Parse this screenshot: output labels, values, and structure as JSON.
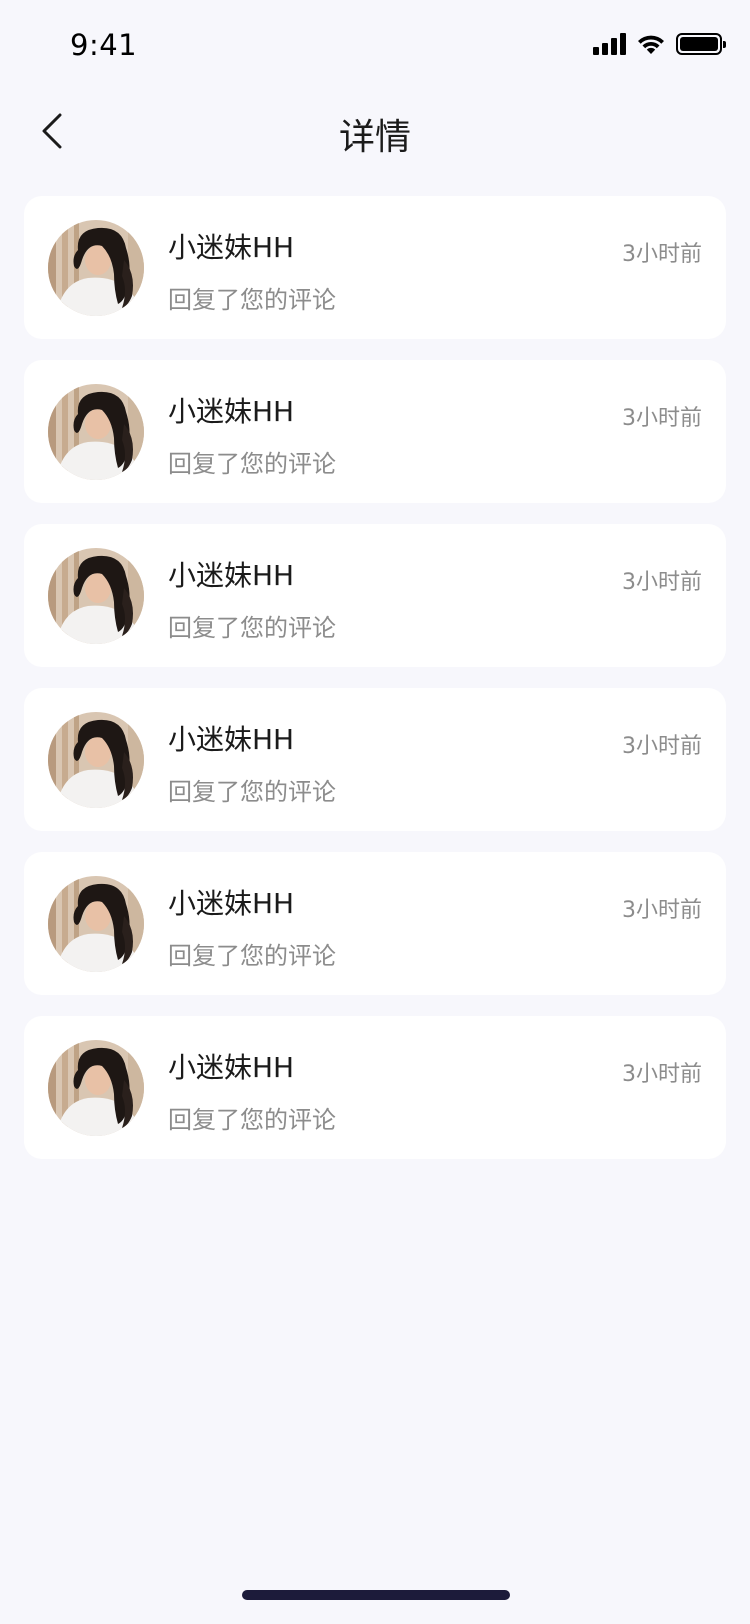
{
  "status_bar": {
    "time": "9:41"
  },
  "nav": {
    "title": "详情",
    "back_icon": "chevron-left-icon"
  },
  "notifications": [
    {
      "name": "小迷妹HH",
      "message": "回复了您的评论",
      "time": "3小时前"
    },
    {
      "name": "小迷妹HH",
      "message": "回复了您的评论",
      "time": "3小时前"
    },
    {
      "name": "小迷妹HH",
      "message": "回复了您的评论",
      "time": "3小时前"
    },
    {
      "name": "小迷妹HH",
      "message": "回复了您的评论",
      "time": "3小时前"
    },
    {
      "name": "小迷妹HH",
      "message": "回复了您的评论",
      "time": "3小时前"
    },
    {
      "name": "小迷妹HH",
      "message": "回复了您的评论",
      "time": "3小时前"
    }
  ],
  "colors": {
    "background": "#F7F7FC",
    "card": "#FFFFFF",
    "text_primary": "#1B1B1B",
    "text_secondary": "#8C8C8C",
    "home_indicator": "#1C1B3A"
  }
}
